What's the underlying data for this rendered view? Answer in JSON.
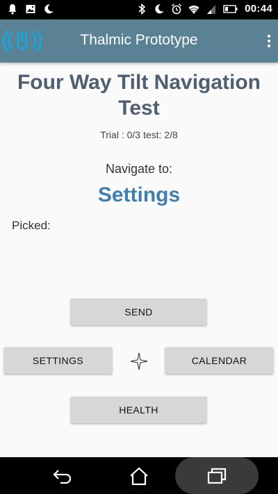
{
  "status_bar": {
    "time": "00:44",
    "left_icons": [
      "notification-bell-icon",
      "image-icon",
      "moon-icon"
    ],
    "right_icons": [
      "bluetooth-icon",
      "do-not-disturb-moon-icon",
      "alarm-icon",
      "wifi-icon",
      "signal-icon",
      "battery-icon"
    ]
  },
  "app_bar": {
    "title": "Thalmic Prototype",
    "logo_icon": "myo-armband-logo-icon",
    "overflow_icon": "more-vert-icon",
    "background_color": "#5a8294"
  },
  "main": {
    "heading": "Four Way Tilt Navigation Test",
    "trial_text": "Trial : 0/3 test: 2/8",
    "navigate_label": "Navigate to:",
    "target": "Settings",
    "picked_label": "Picked:",
    "target_color": "#3f7eae",
    "heading_color": "#4f5f70"
  },
  "buttons": {
    "up": "SEND",
    "left": "SETTINGS",
    "right": "CALENDAR",
    "down": "HEALTH",
    "center_icon": "four-point-star-crosshair-icon"
  },
  "nav_bar": {
    "back_icon": "back-icon",
    "home_icon": "home-icon",
    "recents_icon": "recent-apps-icon"
  }
}
